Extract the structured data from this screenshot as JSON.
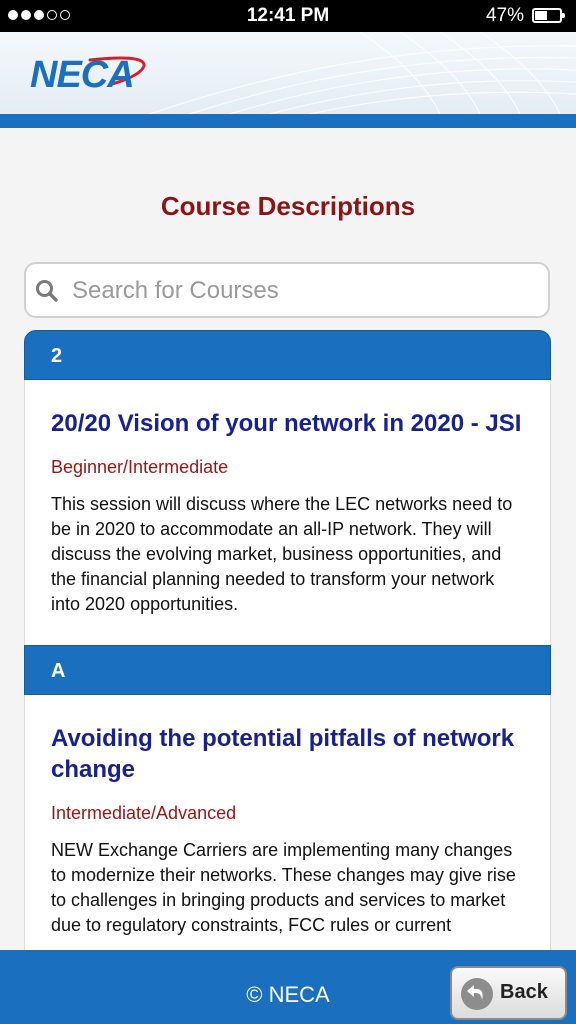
{
  "status_bar": {
    "time": "12:41 PM",
    "battery": "47%"
  },
  "header": {
    "logo": "NECA"
  },
  "page": {
    "title": "Course Descriptions"
  },
  "search": {
    "placeholder": "Search for Courses",
    "value": ""
  },
  "groups": [
    {
      "letter": "2",
      "course": {
        "title": "20/20 Vision of your network in 2020 - JSI",
        "level": "Beginner/Intermediate",
        "description": "This session will discuss where the LEC networks need to be in 2020 to accommodate an all-IP network. They will discuss the evolving market, business opportunities, and the financial planning needed to transform your network into 2020 opportunities."
      }
    },
    {
      "letter": "A",
      "course": {
        "title": "Avoiding the potential pitfalls of network change",
        "level": "Intermediate/Advanced",
        "description": "NEW Exchange Carriers are implementing many changes to modernize their networks. These changes may give rise to challenges in bringing products and services to market due to regulatory constraints, FCC rules or current"
      }
    }
  ],
  "footer": {
    "copyright": "© NECA",
    "back_label": "Back"
  },
  "colors": {
    "brand_blue": "#1b6fbf",
    "title_red": "#8b1414",
    "course_title": "#17218f"
  }
}
